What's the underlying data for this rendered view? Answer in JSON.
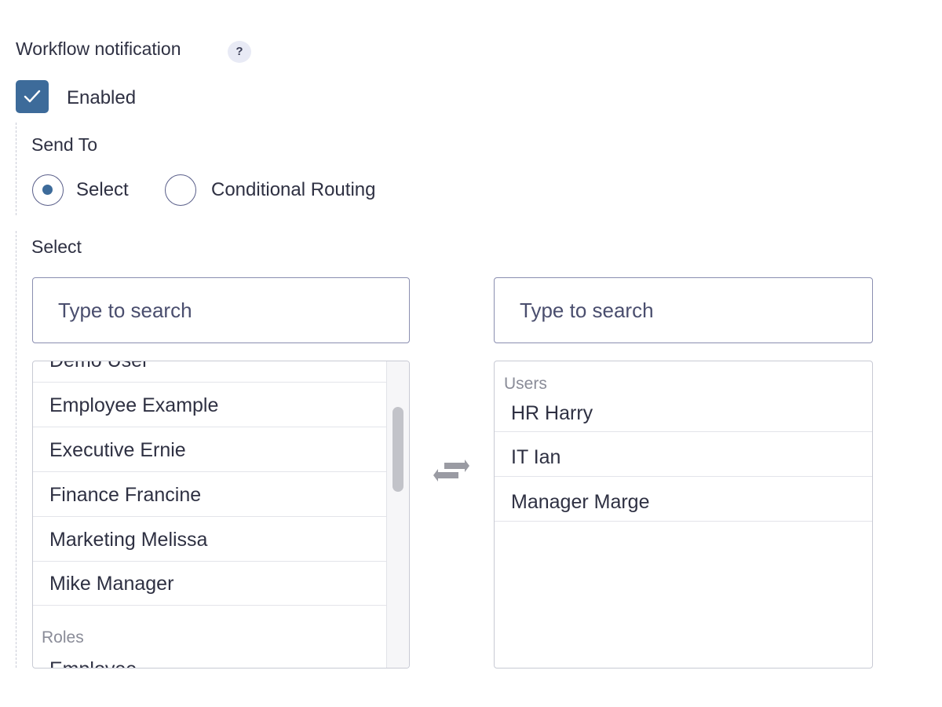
{
  "section": {
    "title": "Workflow notification",
    "help_icon_text": "?"
  },
  "enabled": {
    "label": "Enabled",
    "checked": true
  },
  "send_to": {
    "label": "Send To",
    "options": [
      {
        "label": "Select",
        "selected": true
      },
      {
        "label": "Conditional Routing",
        "selected": false
      }
    ]
  },
  "select": {
    "label": "Select",
    "available": {
      "search_placeholder": "Type to search",
      "items": [
        {
          "type": "item",
          "label": "Demo User"
        },
        {
          "type": "item",
          "label": "Employee Example"
        },
        {
          "type": "item",
          "label": "Executive Ernie"
        },
        {
          "type": "item",
          "label": "Finance Francine"
        },
        {
          "type": "item",
          "label": "Marketing Melissa"
        },
        {
          "type": "item",
          "label": "Mike Manager"
        },
        {
          "type": "group",
          "label": "Roles"
        },
        {
          "type": "item",
          "label": "Employee"
        }
      ]
    },
    "selected": {
      "search_placeholder": "Type to search",
      "group_label": "Users",
      "items": [
        "HR Harry",
        "IT Ian",
        "Manager Marge"
      ]
    }
  },
  "colors": {
    "accent": "#3d6b9a",
    "border": "#8a8eb0"
  },
  "icons": {
    "help": "question-mark-icon",
    "check": "check-icon",
    "swap": "swap-arrows-icon"
  }
}
